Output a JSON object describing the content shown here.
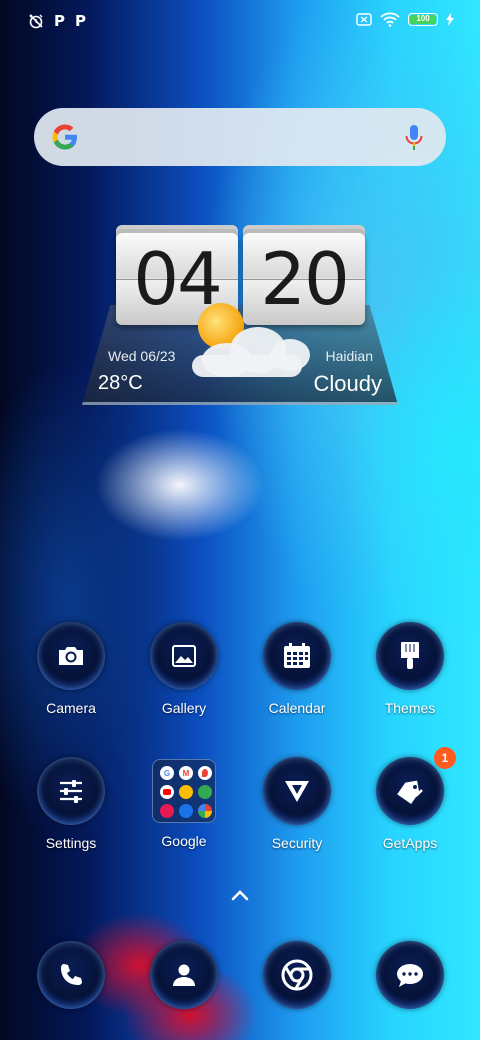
{
  "status_bar": {
    "left_icons": [
      "alarm-off-icon",
      "p-notification-icon",
      "p-notification-icon"
    ],
    "p_glyph": "P",
    "right_icons": [
      "sim-x-icon",
      "wifi-icon",
      "battery-icon",
      "charging-icon"
    ],
    "battery_level": "100",
    "battery_color": "#46d35a"
  },
  "search_bar": {
    "icons": [
      "google-g-icon",
      "microphone-icon"
    ]
  },
  "clock_widget": {
    "hours": "04",
    "minutes": "20",
    "date": "Wed  06/23",
    "city": "Haidian",
    "temperature": "28°C",
    "condition": "Cloudy",
    "weather_icon": "sun-cloud-icon"
  },
  "apps": {
    "row1": [
      {
        "label": "Camera",
        "icon": "camera-icon"
      },
      {
        "label": "Gallery",
        "icon": "gallery-icon"
      },
      {
        "label": "Calendar",
        "icon": "calendar-icon"
      },
      {
        "label": "Themes",
        "icon": "brush-icon"
      }
    ],
    "row2": [
      {
        "label": "Settings",
        "icon": "sliders-icon"
      },
      {
        "label": "Google",
        "icon": "folder-icon"
      },
      {
        "label": "Security",
        "icon": "security-icon"
      },
      {
        "label": "GetApps",
        "icon": "getapps-icon",
        "badge": "1"
      }
    ]
  },
  "google_folder": {
    "mini_letters": [
      "G",
      "M",
      "",
      "",
      "",
      "",
      "",
      "",
      ""
    ]
  },
  "dock": [
    {
      "icon": "phone-icon"
    },
    {
      "icon": "contacts-icon"
    },
    {
      "icon": "chrome-icon"
    },
    {
      "icon": "messages-icon"
    }
  ],
  "colors": {
    "badge": "#ff5a1f",
    "search_bg": "#e1e8f0"
  }
}
